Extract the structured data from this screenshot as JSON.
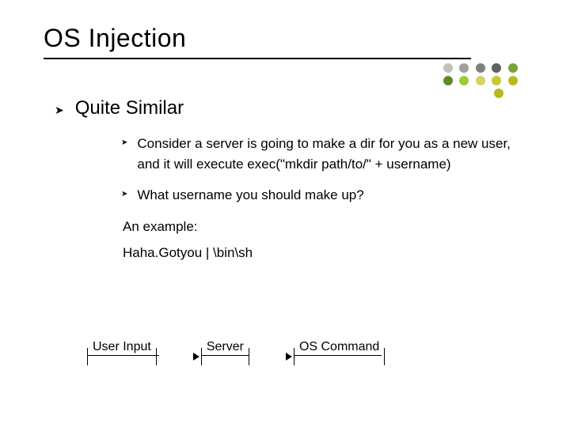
{
  "title": "OS Injection",
  "level1": {
    "text": "Quite Similar"
  },
  "bullets": [
    "Consider a server is going to make a dir for you as a new user, and it will execute exec(\"mkdir path/to/\" + username)",
    "What username you should make up?"
  ],
  "plain": [
    "An example:",
    "Haha.Gotyou | \\bin\\sh"
  ],
  "flow": {
    "boxes": [
      "User Input",
      "Server",
      "OS Command"
    ]
  },
  "dot_colors": [
    "#c0c0c0",
    "#a0a0a0",
    "#808080",
    "#606060",
    "#7aa23c",
    "#5e8a2a",
    "#9acd32",
    "#d4d462",
    "#c8c830",
    "#b8b820"
  ]
}
